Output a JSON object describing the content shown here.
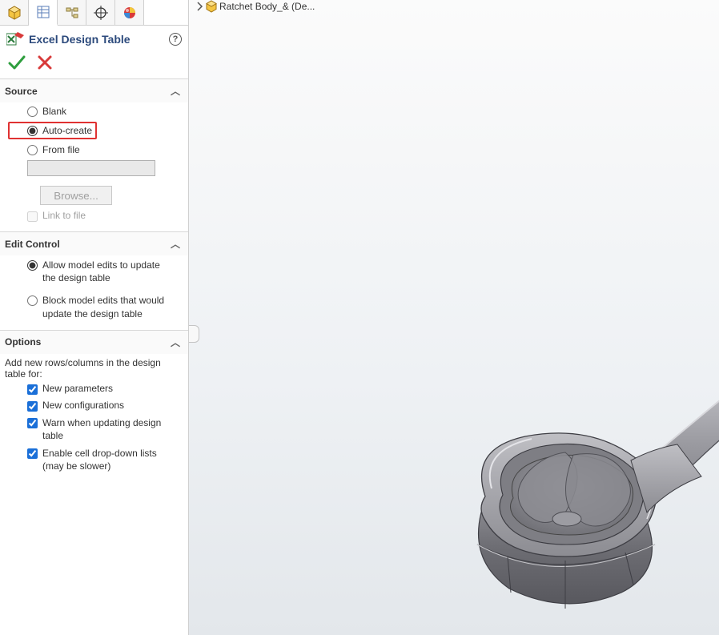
{
  "panel": {
    "title": "Excel Design Table",
    "help_glyph": "?"
  },
  "source": {
    "header": "Source",
    "radios": {
      "blank": "Blank",
      "auto_create": "Auto-create",
      "from_file": "From file"
    },
    "browse_label": "Browse...",
    "link_to_file": "Link to file",
    "selected": "auto_create"
  },
  "edit_control": {
    "header": "Edit Control",
    "allow": "Allow model edits to update the design table",
    "block": "Block model edits that would update the design table",
    "selected": "allow"
  },
  "options": {
    "header": "Options",
    "intro": "Add new rows/columns in the design table for:",
    "new_parameters": "New parameters",
    "new_configurations": "New configurations",
    "warn_updating": "Warn when updating design table",
    "enable_dropdown": "Enable cell drop-down lists (may be slower)"
  },
  "breadcrumb": {
    "item_label": "Ratchet Body_& (De..."
  },
  "icons": {
    "accept": "accept",
    "cancel": "cancel"
  }
}
